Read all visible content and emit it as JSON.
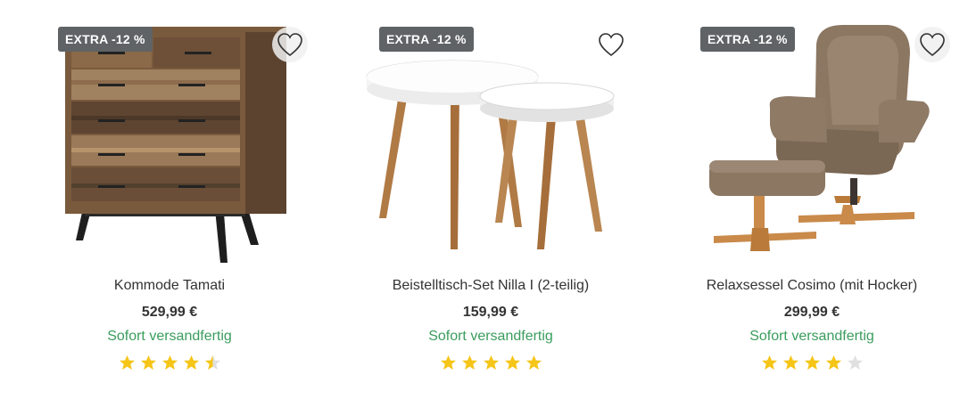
{
  "products": [
    {
      "badge": "EXTRA -12 %",
      "title": "Kommode Tamati",
      "price": "529,99 €",
      "availability": "Sofort versandfertig",
      "rating": 4.5,
      "wishlist_icon": "heart-outline-icon"
    },
    {
      "badge": "EXTRA -12 %",
      "title": "Beistelltisch-Set Nilla I (2-teilig)",
      "price": "159,99 €",
      "availability": "Sofort versandfertig",
      "rating": 5,
      "wishlist_icon": "heart-outline-icon"
    },
    {
      "badge": "EXTRA -12 %",
      "title": "Relaxsessel Cosimo (mit Hocker)",
      "price": "299,99 €",
      "availability": "Sofort versandfertig",
      "rating": 4,
      "wishlist_icon": "heart-outline-icon"
    }
  ],
  "colors": {
    "badge_bg": "#5f6366",
    "availability": "#3a9d5d",
    "star_filled": "#f5c518",
    "star_empty": "#e0e0e0"
  }
}
